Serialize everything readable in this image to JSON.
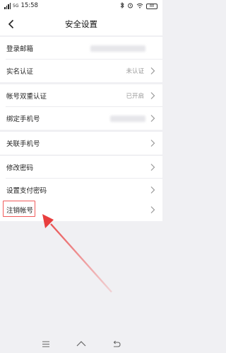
{
  "status_bar": {
    "signal_text": "5G",
    "time": "15:58",
    "battery": "88"
  },
  "header": {
    "title": "安全设置"
  },
  "rows": [
    {
      "label": "登录邮箱",
      "value": ""
    },
    {
      "label": "实名认证",
      "value": "未认证"
    },
    {
      "label": "帐号双重认证",
      "value": "已开启"
    },
    {
      "label": "绑定手机号",
      "value": ""
    },
    {
      "label": "关联手机号",
      "value": ""
    },
    {
      "label": "修改密码",
      "value": ""
    },
    {
      "label": "设置支付密码",
      "value": ""
    },
    {
      "label": "注销帐号",
      "value": ""
    }
  ],
  "colors": {
    "highlight": "#f05a5a",
    "background": "#f0f0f3"
  }
}
